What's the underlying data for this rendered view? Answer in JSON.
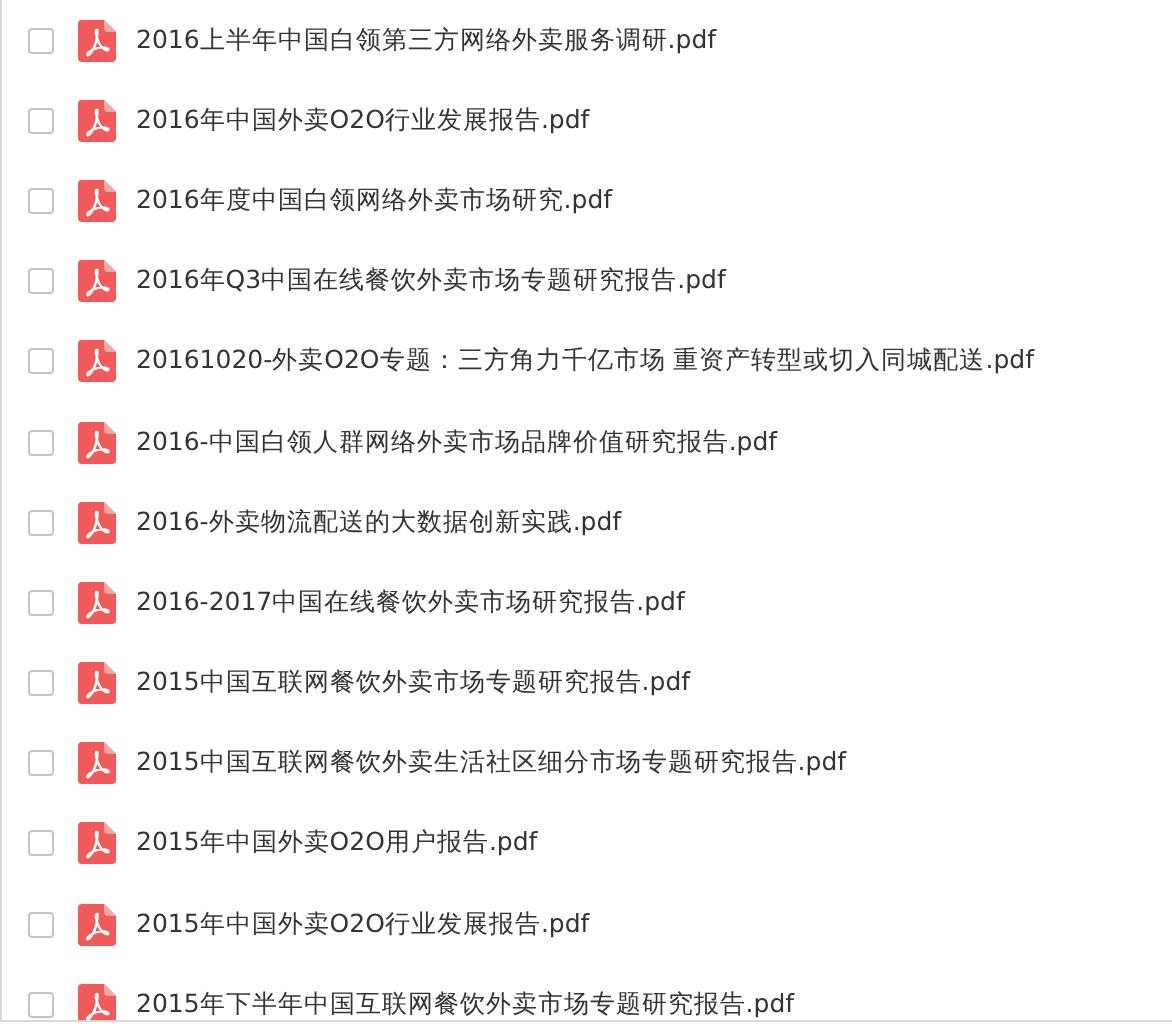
{
  "files": [
    {
      "name": "2016上半年中国白领第三方网络外卖服务调研.pdf",
      "checked": false
    },
    {
      "name": "2016年中国外卖O2O行业发展报告.pdf",
      "checked": false
    },
    {
      "name": "2016年度中国白领网络外卖市场研究.pdf",
      "checked": false
    },
    {
      "name": "2016年Q3中国在线餐饮外卖市场专题研究报告.pdf",
      "checked": false
    },
    {
      "name": "20161020-外卖O2O专题：三方角力千亿市场 重资产转型或切入同城配送.pdf",
      "checked": false
    },
    {
      "name": "2016-中国白领人群网络外卖市场品牌价值研究报告.pdf",
      "checked": false
    },
    {
      "name": "2016-外卖物流配送的大数据创新实践.pdf",
      "checked": false
    },
    {
      "name": "2016-2017中国在线餐饮外卖市场研究报告.pdf",
      "checked": false
    },
    {
      "name": "2015中国互联网餐饮外卖市场专题研究报告.pdf",
      "checked": false
    },
    {
      "name": "2015中国互联网餐饮外卖生活社区细分市场专题研究报告.pdf",
      "checked": false
    },
    {
      "name": "2015年中国外卖O2O用户报告.pdf",
      "checked": false
    },
    {
      "name": "2015年中国外卖O2O行业发展报告.pdf",
      "checked": false
    },
    {
      "name": "2015年下半年中国互联网餐饮外卖市场专题研究报告.pdf",
      "checked": false
    }
  ]
}
